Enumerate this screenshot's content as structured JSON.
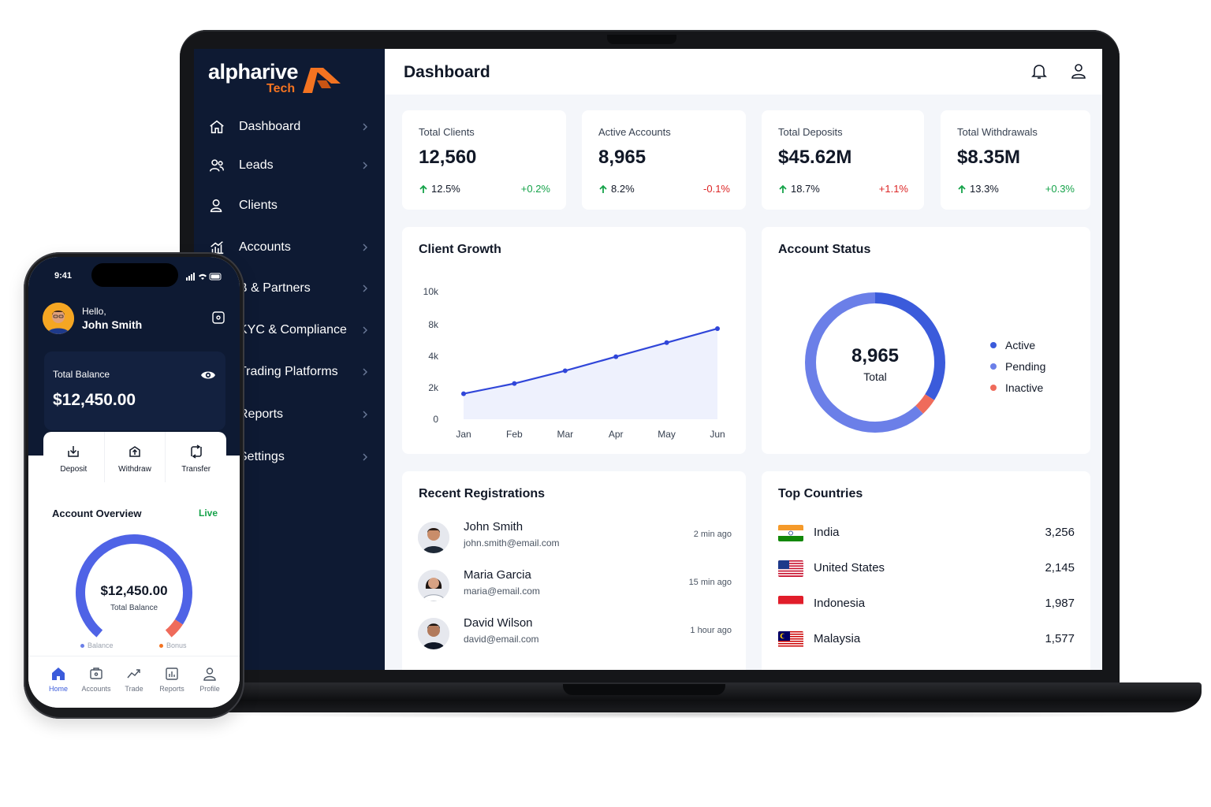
{
  "app": {
    "logo_text": "alpharive",
    "logo_sub": "Tech"
  },
  "colors": {
    "sidebar": "#0e1a33",
    "accent": "#3b5bdb",
    "brand_orange": "#f37321",
    "positive": "#16a34a",
    "negative": "#dc2626"
  },
  "sidebar": {
    "items": [
      {
        "label": "Dashboard",
        "icon": "home-icon"
      },
      {
        "label": "Leads",
        "icon": "users-icon"
      },
      {
        "label": "Clients",
        "icon": "user-group-icon"
      },
      {
        "label": "Accounts",
        "icon": "chart-icon"
      },
      {
        "label": "B & Partners",
        "icon": "partners-icon"
      },
      {
        "label": "KYC & Compliance",
        "icon": "shield-icon"
      },
      {
        "label": "Trading Platforms",
        "icon": "platform-icon"
      },
      {
        "label": "Reports",
        "icon": "report-icon"
      },
      {
        "label": "Settings",
        "icon": "settings-icon"
      }
    ]
  },
  "header": {
    "title": "Dashboard",
    "icons": [
      "bell-icon",
      "user-icon"
    ]
  },
  "stats": [
    {
      "label": "Total Clients",
      "value": "12,560",
      "growth": "12.5%",
      "change": "+0.2%",
      "trend": "positive"
    },
    {
      "label": "Active Accounts",
      "value": "8,965",
      "growth": "8.2%",
      "change": "-0.1%",
      "trend": "negative"
    },
    {
      "label": "Total Deposits",
      "value": "$45.62M",
      "growth": "18.7%",
      "change": "+1.1%",
      "trend": "negative"
    },
    {
      "label": "Total Withdrawals",
      "value": "$8.35M",
      "growth": "13.3%",
      "change": "+0.3%",
      "trend": "positive"
    }
  ],
  "client_growth": {
    "title": "Client Growth"
  },
  "chart_data": {
    "type": "area",
    "title": "Client Growth",
    "categories": [
      "Jan",
      "Feb",
      "Mar",
      "Apr",
      "May",
      "Jun"
    ],
    "y_ticks": [
      "0",
      "2k",
      "4k",
      "8k",
      "10k"
    ],
    "series": [
      {
        "values": [
          2000,
          2800,
          3800,
          4900,
          6000,
          7100
        ]
      }
    ],
    "ylim": [
      0,
      10000
    ],
    "grid": false
  },
  "account_status": {
    "title": "Account Status",
    "total_value": "8,965",
    "total_label": "Total",
    "legend": [
      {
        "label": "Active",
        "color": "#3b5bdb"
      },
      {
        "label": "Pending",
        "color": "#6b7fe8"
      },
      {
        "label": "Inactive",
        "color": "#ef6b5b"
      }
    ],
    "segments": [
      {
        "color": "#3b5bdb",
        "fraction": 0.34
      },
      {
        "color": "#ef6b5b",
        "fraction": 0.04
      },
      {
        "color": "#6b7fe8",
        "fraction": 0.62
      }
    ]
  },
  "recent_registrations": {
    "title": "Recent Registrations",
    "rows": [
      {
        "name": "John Smith",
        "email": "john.smith@email.com",
        "time": "2 min ago"
      },
      {
        "name": "Maria Garcia",
        "email": "maria@email.com",
        "time": "15 min ago"
      },
      {
        "name": "David Wilson",
        "email": "david@email.com",
        "time": "1 hour ago"
      }
    ]
  },
  "top_countries": {
    "title": "Top Countries",
    "rows": [
      {
        "name": "India",
        "count": "3,256",
        "flag": "india-flag"
      },
      {
        "name": "United States",
        "count": "2,145",
        "flag": "us-flag"
      },
      {
        "name": "Indonesia",
        "count": "1,987",
        "flag": "indonesia-flag"
      },
      {
        "name": "Malaysia",
        "count": "1,577",
        "flag": "malaysia-flag"
      }
    ]
  },
  "phone": {
    "time": "9:41",
    "hello": "Hello,",
    "user_name": "John Smith",
    "balance_label": "Total Balance",
    "balance_value": "$12,450.00",
    "actions": [
      {
        "label": "Deposit",
        "icon": "deposit-icon"
      },
      {
        "label": "Withdraw",
        "icon": "withdraw-icon"
      },
      {
        "label": "Transfer",
        "icon": "transfer-icon"
      }
    ],
    "overview_title": "Account Overview",
    "overview_status": "Live",
    "gauge_value": "$12,450.00",
    "gauge_label": "Total Balance",
    "gauge_fill": 0.94,
    "gauge_legend": [
      {
        "label": "Balance",
        "color": "#6b7fe8"
      },
      {
        "label": "Bonus",
        "color": "#f37321"
      }
    ],
    "tabs": [
      {
        "label": "Home",
        "icon": "home-icon",
        "active": true
      },
      {
        "label": "Accounts",
        "icon": "wallet-icon"
      },
      {
        "label": "Trade",
        "icon": "trend-icon"
      },
      {
        "label": "Reports",
        "icon": "report-icon"
      },
      {
        "label": "Profile",
        "icon": "profile-icon"
      }
    ]
  }
}
